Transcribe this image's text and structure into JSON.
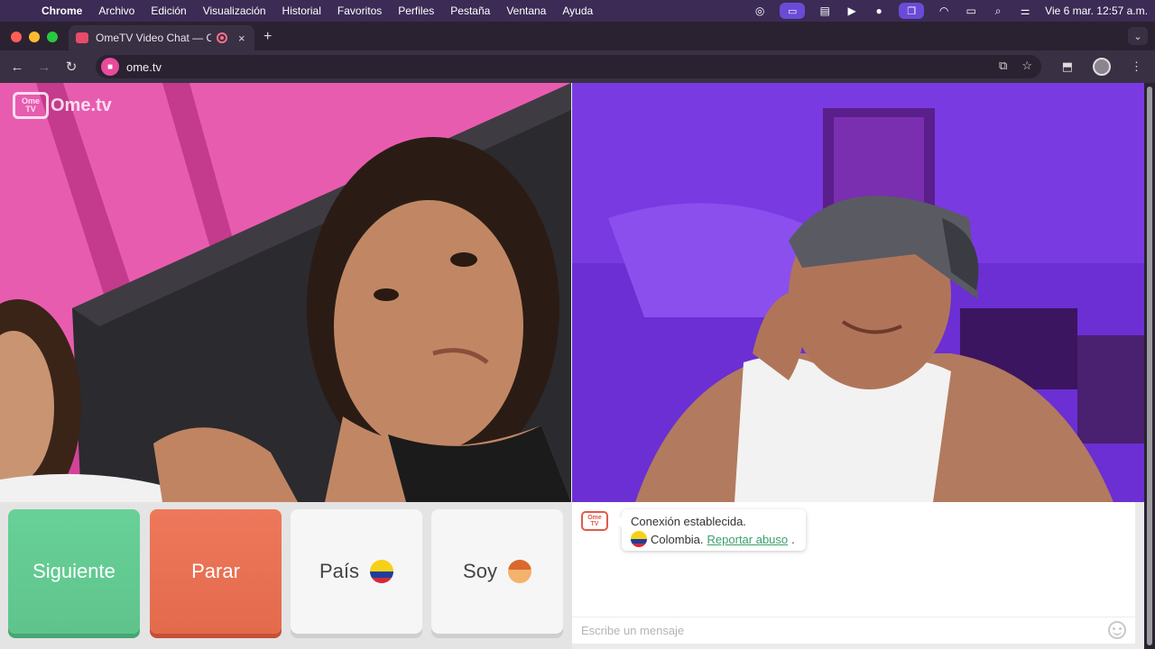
{
  "menubar": {
    "app": "Chrome",
    "items": [
      "Archivo",
      "Edición",
      "Visualización",
      "Historial",
      "Favoritos",
      "Perfiles",
      "Pestaña",
      "Ventana",
      "Ayuda"
    ],
    "clock": "Vie 6 mar.  12:57 a.m."
  },
  "tab": {
    "title": "OmeTV Video Chat — Om",
    "close": "×",
    "new_tab": "+"
  },
  "toolbar": {
    "url": "ome.tv"
  },
  "logo": {
    "tv_top": "Ome",
    "tv_bottom": "TV",
    "word": "Ome.tv"
  },
  "controls": {
    "next_label": "Siguiente",
    "stop_label": "Parar",
    "country_label": "País",
    "gender_label": "Soy"
  },
  "chat": {
    "bot_top": "Ome",
    "bot_bottom": "TV",
    "message_line1": "Conexión establecida.",
    "country": "Colombia.",
    "report_link": "Reportar abuso",
    "trailing": ".",
    "input_placeholder": "Escribe un mensaje"
  },
  "colors": {
    "next": "#5fc48c",
    "stop": "#e46a4c",
    "link": "#3aa06a"
  }
}
